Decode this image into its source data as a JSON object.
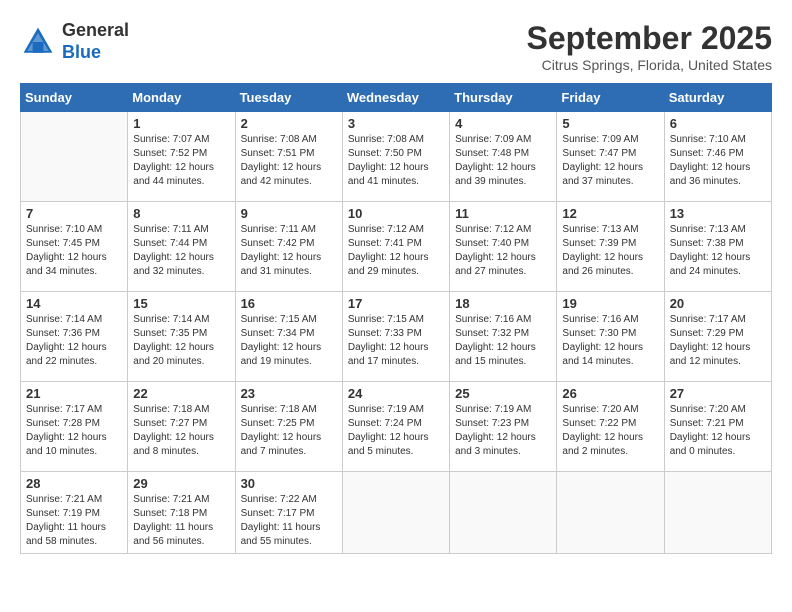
{
  "header": {
    "logo_general": "General",
    "logo_blue": "Blue",
    "month_year": "September 2025",
    "location": "Citrus Springs, Florida, United States"
  },
  "days_of_week": [
    "Sunday",
    "Monday",
    "Tuesday",
    "Wednesday",
    "Thursday",
    "Friday",
    "Saturday"
  ],
  "weeks": [
    [
      {
        "day": "",
        "info": ""
      },
      {
        "day": "1",
        "info": "Sunrise: 7:07 AM\nSunset: 7:52 PM\nDaylight: 12 hours\nand 44 minutes."
      },
      {
        "day": "2",
        "info": "Sunrise: 7:08 AM\nSunset: 7:51 PM\nDaylight: 12 hours\nand 42 minutes."
      },
      {
        "day": "3",
        "info": "Sunrise: 7:08 AM\nSunset: 7:50 PM\nDaylight: 12 hours\nand 41 minutes."
      },
      {
        "day": "4",
        "info": "Sunrise: 7:09 AM\nSunset: 7:48 PM\nDaylight: 12 hours\nand 39 minutes."
      },
      {
        "day": "5",
        "info": "Sunrise: 7:09 AM\nSunset: 7:47 PM\nDaylight: 12 hours\nand 37 minutes."
      },
      {
        "day": "6",
        "info": "Sunrise: 7:10 AM\nSunset: 7:46 PM\nDaylight: 12 hours\nand 36 minutes."
      }
    ],
    [
      {
        "day": "7",
        "info": "Sunrise: 7:10 AM\nSunset: 7:45 PM\nDaylight: 12 hours\nand 34 minutes."
      },
      {
        "day": "8",
        "info": "Sunrise: 7:11 AM\nSunset: 7:44 PM\nDaylight: 12 hours\nand 32 minutes."
      },
      {
        "day": "9",
        "info": "Sunrise: 7:11 AM\nSunset: 7:42 PM\nDaylight: 12 hours\nand 31 minutes."
      },
      {
        "day": "10",
        "info": "Sunrise: 7:12 AM\nSunset: 7:41 PM\nDaylight: 12 hours\nand 29 minutes."
      },
      {
        "day": "11",
        "info": "Sunrise: 7:12 AM\nSunset: 7:40 PM\nDaylight: 12 hours\nand 27 minutes."
      },
      {
        "day": "12",
        "info": "Sunrise: 7:13 AM\nSunset: 7:39 PM\nDaylight: 12 hours\nand 26 minutes."
      },
      {
        "day": "13",
        "info": "Sunrise: 7:13 AM\nSunset: 7:38 PM\nDaylight: 12 hours\nand 24 minutes."
      }
    ],
    [
      {
        "day": "14",
        "info": "Sunrise: 7:14 AM\nSunset: 7:36 PM\nDaylight: 12 hours\nand 22 minutes."
      },
      {
        "day": "15",
        "info": "Sunrise: 7:14 AM\nSunset: 7:35 PM\nDaylight: 12 hours\nand 20 minutes."
      },
      {
        "day": "16",
        "info": "Sunrise: 7:15 AM\nSunset: 7:34 PM\nDaylight: 12 hours\nand 19 minutes."
      },
      {
        "day": "17",
        "info": "Sunrise: 7:15 AM\nSunset: 7:33 PM\nDaylight: 12 hours\nand 17 minutes."
      },
      {
        "day": "18",
        "info": "Sunrise: 7:16 AM\nSunset: 7:32 PM\nDaylight: 12 hours\nand 15 minutes."
      },
      {
        "day": "19",
        "info": "Sunrise: 7:16 AM\nSunset: 7:30 PM\nDaylight: 12 hours\nand 14 minutes."
      },
      {
        "day": "20",
        "info": "Sunrise: 7:17 AM\nSunset: 7:29 PM\nDaylight: 12 hours\nand 12 minutes."
      }
    ],
    [
      {
        "day": "21",
        "info": "Sunrise: 7:17 AM\nSunset: 7:28 PM\nDaylight: 12 hours\nand 10 minutes."
      },
      {
        "day": "22",
        "info": "Sunrise: 7:18 AM\nSunset: 7:27 PM\nDaylight: 12 hours\nand 8 minutes."
      },
      {
        "day": "23",
        "info": "Sunrise: 7:18 AM\nSunset: 7:25 PM\nDaylight: 12 hours\nand 7 minutes."
      },
      {
        "day": "24",
        "info": "Sunrise: 7:19 AM\nSunset: 7:24 PM\nDaylight: 12 hours\nand 5 minutes."
      },
      {
        "day": "25",
        "info": "Sunrise: 7:19 AM\nSunset: 7:23 PM\nDaylight: 12 hours\nand 3 minutes."
      },
      {
        "day": "26",
        "info": "Sunrise: 7:20 AM\nSunset: 7:22 PM\nDaylight: 12 hours\nand 2 minutes."
      },
      {
        "day": "27",
        "info": "Sunrise: 7:20 AM\nSunset: 7:21 PM\nDaylight: 12 hours\nand 0 minutes."
      }
    ],
    [
      {
        "day": "28",
        "info": "Sunrise: 7:21 AM\nSunset: 7:19 PM\nDaylight: 11 hours\nand 58 minutes."
      },
      {
        "day": "29",
        "info": "Sunrise: 7:21 AM\nSunset: 7:18 PM\nDaylight: 11 hours\nand 56 minutes."
      },
      {
        "day": "30",
        "info": "Sunrise: 7:22 AM\nSunset: 7:17 PM\nDaylight: 11 hours\nand 55 minutes."
      },
      {
        "day": "",
        "info": ""
      },
      {
        "day": "",
        "info": ""
      },
      {
        "day": "",
        "info": ""
      },
      {
        "day": "",
        "info": ""
      }
    ]
  ]
}
